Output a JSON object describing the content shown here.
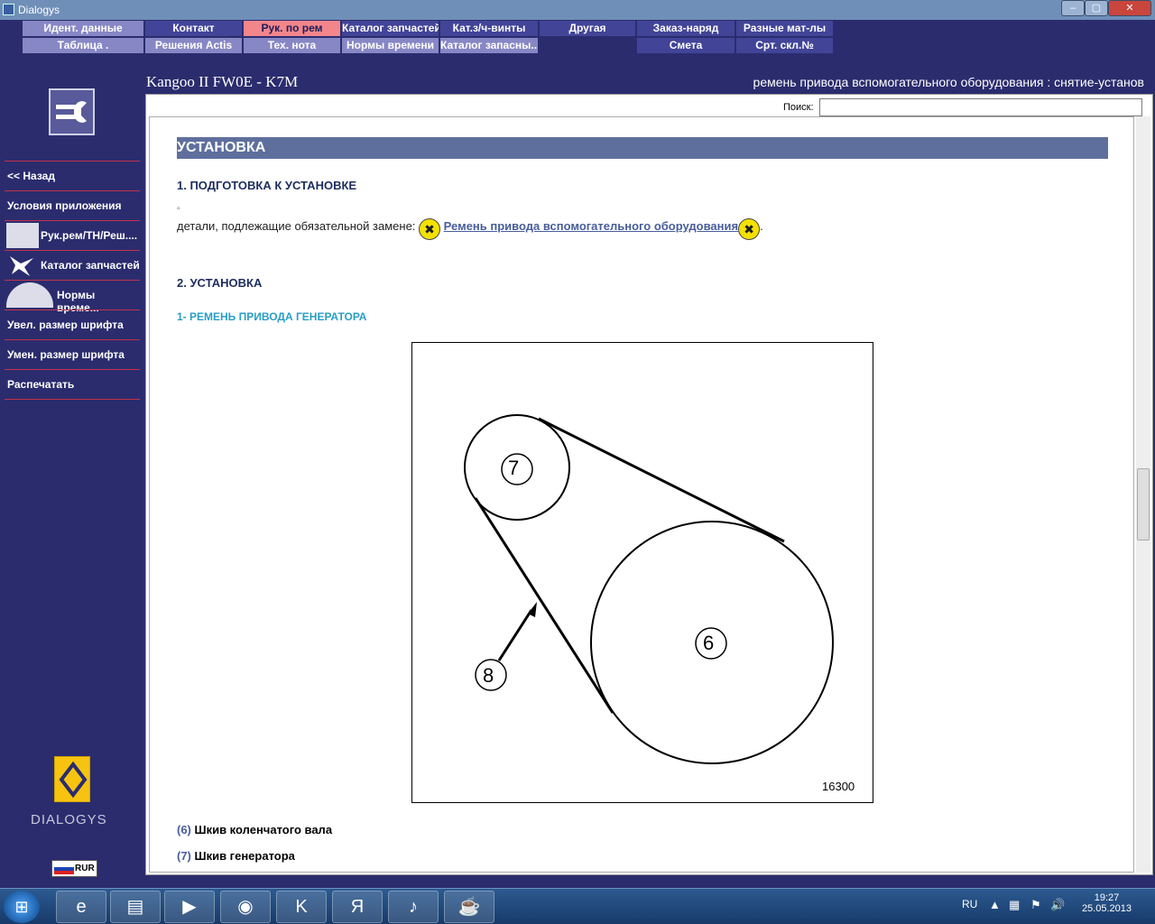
{
  "window": {
    "title": "Dialogys",
    "min": "–",
    "max": "▢",
    "close": "✕"
  },
  "menu_row1": [
    "Идент. данные",
    "Контакт",
    "Рук. по рем",
    "Каталог запчастей",
    "Кат.з/ч-винты",
    "Другая",
    "Заказ-наряд",
    "Разные мат-лы"
  ],
  "menu_row2": [
    "Таблица .",
    "Решения Actis",
    "Тех. нота",
    "Нормы времени",
    "Каталог запасны...",
    "Смета",
    "Срт. скл.№"
  ],
  "sidebar": [
    "<< Назад",
    "Условия приложения",
    "Рук.рем/ТН/Реш....",
    "Каталог запчастей",
    "Нормы време...",
    "Увел. размер шрифта",
    "Умен. размер шрифта",
    "Распечатать"
  ],
  "header": {
    "vehicle": "Kangoo II FW0E - K7M",
    "operation": "ремень привода вспомогательного оборудования : снятие-установ"
  },
  "search": {
    "label": "Поиск:",
    "value": ""
  },
  "doc": {
    "section": "УСТАНОВКА",
    "h1": "1. ПОДГОТОВКА К УСТАНОВКЕ",
    "bullet": "▫",
    "replace_text": "детали, подлежащие обязательной замене:",
    "replace_link": "Ремень привода вспомогательного оборудования",
    "replace_end": ".",
    "h2": "2. УСТАНОВКА",
    "h3": "1- РЕМЕНЬ ПРИВОДА ГЕНЕРАТОРА",
    "fig_labels": {
      "a": "7",
      "b": "6",
      "c": "8"
    },
    "fig_number": "16300",
    "caption1_num": "(6)",
    "caption1_text": "Шкив коленчатого вала",
    "caption2_num": "(7)",
    "caption2_text": "Шкив генератора"
  },
  "brand": {
    "name": "DIALOGYS",
    "currency": "RUR"
  },
  "tray": {
    "lang": "RU",
    "time": "19:27",
    "date": "25.05.2013"
  }
}
